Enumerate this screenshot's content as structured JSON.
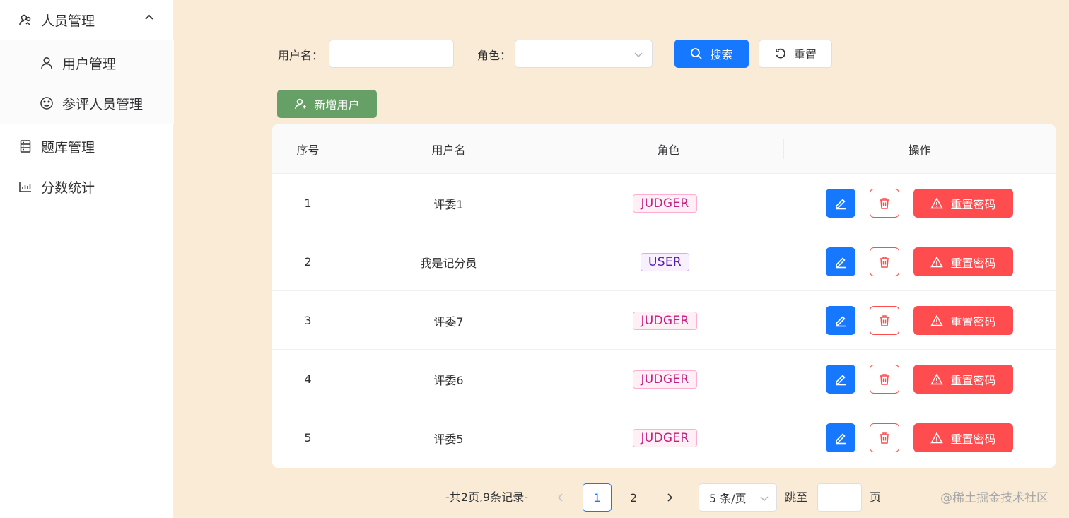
{
  "sidebar": {
    "groups": [
      {
        "label": "人员管理",
        "icon": "users-icon",
        "expanded": true
      },
      {
        "label": "题库管理",
        "icon": "question-bank-icon"
      },
      {
        "label": "分数统计",
        "icon": "bar-chart-icon"
      }
    ],
    "subitems": [
      {
        "label": "用户管理",
        "icon": "user-icon"
      },
      {
        "label": "参评人员管理",
        "icon": "smile-icon"
      }
    ]
  },
  "filter": {
    "username_label": "用户名：",
    "username_value": "",
    "username_placeholder": "",
    "role_label": "角色：",
    "role_value": "",
    "search_label": "搜索",
    "reset_label": "重置"
  },
  "actions": {
    "add_user_label": "新增用户"
  },
  "table": {
    "headers": [
      "序号",
      "用户名",
      "角色",
      "操作"
    ],
    "rows": [
      {
        "index": "1",
        "username": "评委1",
        "role": "JUDGER"
      },
      {
        "index": "2",
        "username": "我是记分员",
        "role": "USER"
      },
      {
        "index": "3",
        "username": "评委7",
        "role": "JUDGER"
      },
      {
        "index": "4",
        "username": "评委6",
        "role": "JUDGER"
      },
      {
        "index": "5",
        "username": "评委5",
        "role": "JUDGER"
      }
    ],
    "reset_password_label": "重置密码"
  },
  "pagination": {
    "summary": "-共2页,9条记录-",
    "pages": [
      "1",
      "2"
    ],
    "current_page": "1",
    "page_size_label": "5 条/页",
    "jump_label": "跳至",
    "jump_value": "",
    "page_suffix": "页"
  },
  "watermark": "@稀土掘金技术社区",
  "colors": {
    "primary": "#1677ff",
    "danger": "#ff4d4f",
    "success": "#67a066",
    "background": "#faebd7",
    "judger_tag": "#c41d7f",
    "user_tag": "#531dab"
  }
}
